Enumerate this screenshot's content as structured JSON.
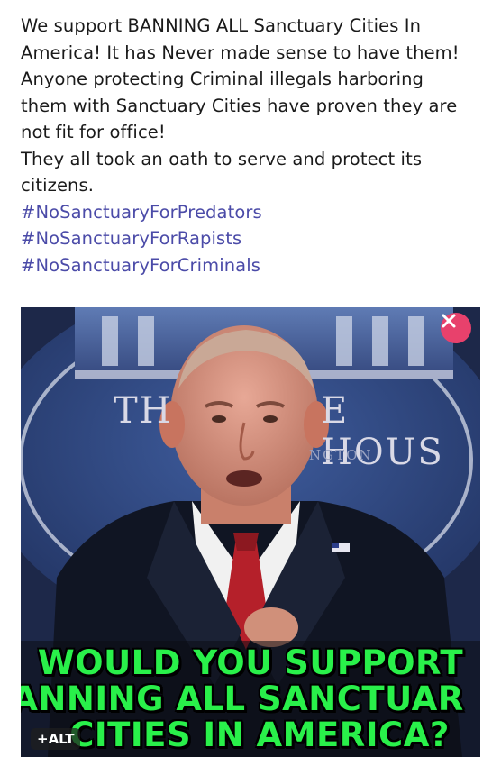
{
  "post": {
    "lines": [
      "We support BANNING ALL Sanctuary Cities In",
      "America! It has Never made sense to have them!",
      " Anyone protecting Criminal illegals harboring",
      "them with Sanctuary Cities have proven they are",
      "not fit for office!",
      "They all took an oath to serve and protect its",
      "citizens."
    ],
    "hashtags": [
      "#NoSanctuaryForPredators",
      "#NoSanctuaryForRapists",
      "#NoSanctuaryForCriminals"
    ]
  },
  "media": {
    "background_sign_left": "TH",
    "background_sign_right": "E HOUS",
    "background_sign_small": "NGTON",
    "overlay_lines": [
      "WOULD YOU SUPPORT",
      "ANNING ALL SANCTUAR",
      "CITIES IN AMERICA?"
    ],
    "alt_label": "+ALT",
    "remove_icon": "close-icon",
    "colors": {
      "overlay_text": "#29f04a",
      "remove_button": "#e8416c",
      "hashtag": "#4b4ba8"
    }
  }
}
